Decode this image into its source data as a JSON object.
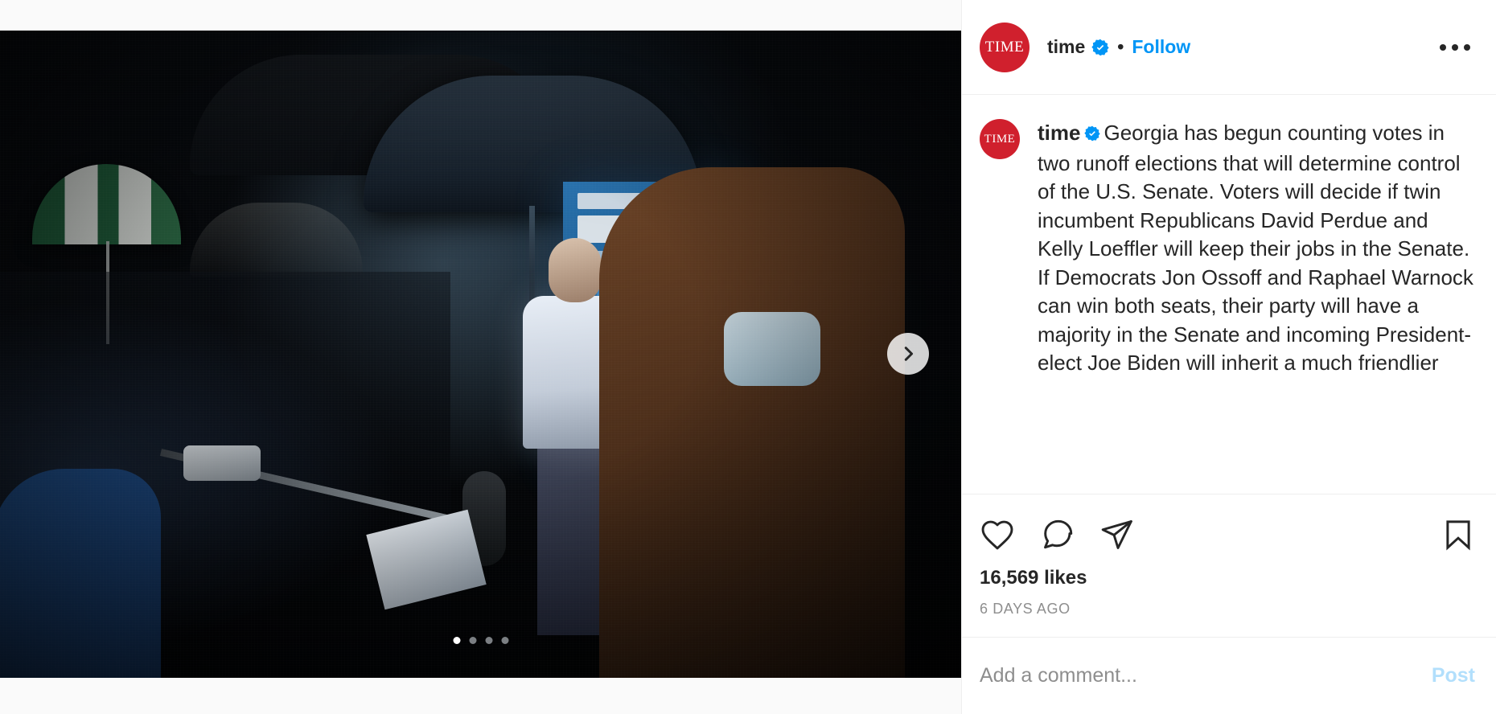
{
  "post": {
    "header": {
      "avatar_text": "TIME",
      "avatar_color": "#d0202d",
      "username": "time",
      "verified_icon": "verified-badge-icon",
      "separator": "•",
      "follow_label": "Follow",
      "more_icon": "more-options-icon"
    },
    "media": {
      "next_icon": "chevron-right-icon",
      "carousel": {
        "total": 4,
        "active_index": 0
      }
    },
    "caption": {
      "avatar_text": "TIME",
      "username": "time",
      "verified_icon": "verified-badge-icon",
      "text": "Georgia has begun counting votes in two runoff elections that will determine control of the U.S. Senate. Voters will decide if twin incumbent Republicans David Perdue and Kelly Loeffler will keep their jobs in the Senate. If Democrats Jon Ossoff and Raphael Warnock can win both seats, their party will have a majority in the Senate and incoming President-elect Joe Biden will inherit a much friendlier"
    },
    "actions": {
      "like_icon": "heart-icon",
      "comment_icon": "comment-icon",
      "share_icon": "share-icon",
      "save_icon": "bookmark-icon",
      "likes": "16,569 likes",
      "timestamp": "6 DAYS AGO"
    },
    "comment_bar": {
      "placeholder": "Add a comment...",
      "value": "",
      "post_label": "Post"
    },
    "colors": {
      "accent": "#0095f6",
      "post_disabled": "#b2dffc",
      "text": "#262626",
      "muted": "#8e8e8e",
      "brand_red": "#d0202d"
    }
  }
}
